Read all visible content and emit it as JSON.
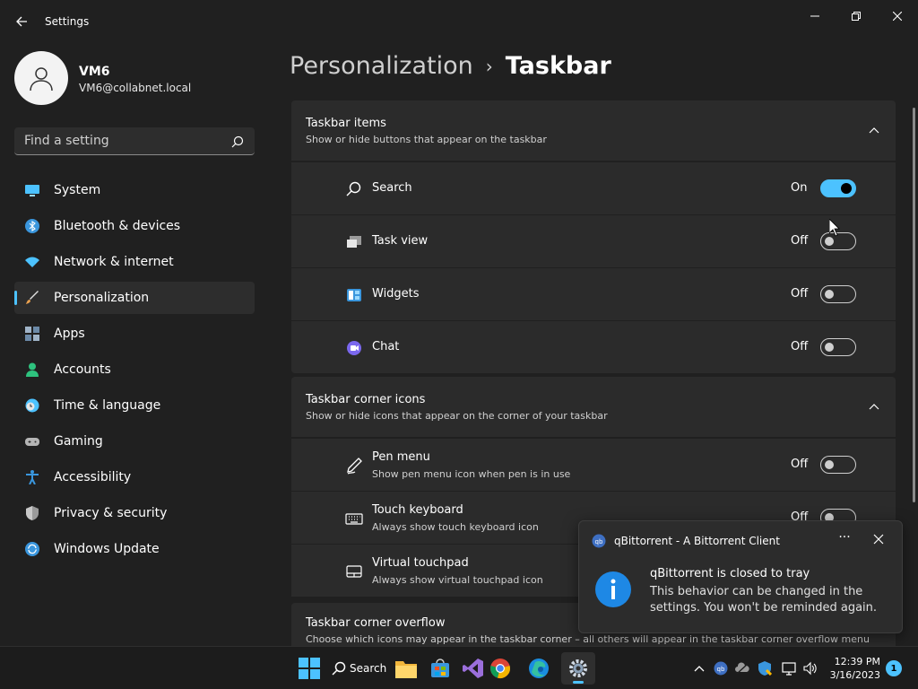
{
  "window": {
    "title": "Settings"
  },
  "profile": {
    "name": "VM6",
    "email": "VM6@collabnet.local"
  },
  "search": {
    "placeholder": "Find a setting"
  },
  "nav": {
    "items": [
      {
        "label": "System",
        "icon": "monitor-icon",
        "color": "#4cc2ff"
      },
      {
        "label": "Bluetooth & devices",
        "icon": "bluetooth-icon",
        "color": "#3a96dd"
      },
      {
        "label": "Network & internet",
        "icon": "wifi-icon",
        "color": "#4cc2ff"
      },
      {
        "label": "Personalization",
        "icon": "brush-icon",
        "color": "#e8a04f"
      },
      {
        "label": "Apps",
        "icon": "apps-icon",
        "color": "#a0b4c8"
      },
      {
        "label": "Accounts",
        "icon": "person-icon",
        "color": "#2ec27e"
      },
      {
        "label": "Time & language",
        "icon": "clock-globe-icon",
        "color": "#4cc2ff"
      },
      {
        "label": "Gaming",
        "icon": "gamepad-icon",
        "color": "#b5b5b5"
      },
      {
        "label": "Accessibility",
        "icon": "accessibility-icon",
        "color": "#3a96dd"
      },
      {
        "label": "Privacy & security",
        "icon": "shield-icon",
        "color": "#9a9a9a"
      },
      {
        "label": "Windows Update",
        "icon": "update-icon",
        "color": "#3a96dd"
      }
    ],
    "active_index": 3
  },
  "breadcrumb": {
    "parent": "Personalization",
    "separator": "›",
    "current": "Taskbar"
  },
  "sections": {
    "taskbar_items": {
      "title": "Taskbar items",
      "subtitle": "Show or hide buttons that appear on the taskbar",
      "rows": [
        {
          "label": "Search",
          "state": "On",
          "on": true
        },
        {
          "label": "Task view",
          "state": "Off",
          "on": false
        },
        {
          "label": "Widgets",
          "state": "Off",
          "on": false
        },
        {
          "label": "Chat",
          "state": "Off",
          "on": false
        }
      ]
    },
    "corner_icons": {
      "title": "Taskbar corner icons",
      "subtitle": "Show or hide icons that appear on the corner of your taskbar",
      "rows": [
        {
          "label": "Pen menu",
          "sub": "Show pen menu icon when pen is in use",
          "state": "Off",
          "on": false
        },
        {
          "label": "Touch keyboard",
          "sub": "Always show touch keyboard icon",
          "state": "Off",
          "on": false
        },
        {
          "label": "Virtual touchpad",
          "sub": "Always show virtual touchpad icon"
        }
      ]
    },
    "overflow": {
      "title": "Taskbar corner overflow",
      "subtitle": "Choose which icons may appear in the taskbar corner – all others will appear in the taskbar corner overflow menu"
    }
  },
  "toast": {
    "app_name": "qBittorrent - A Bittorrent Client",
    "more": "···",
    "title": "qBittorrent is closed to tray",
    "body": "This behavior can be changed in the settings. You won't be reminded again."
  },
  "taskbar": {
    "search_label": "Search",
    "time": "12:39 PM",
    "date": "3/16/2023",
    "notification_count": "1"
  },
  "colors": {
    "accent": "#4cc2ff",
    "background": "#202020",
    "card": "#2b2b2b"
  }
}
